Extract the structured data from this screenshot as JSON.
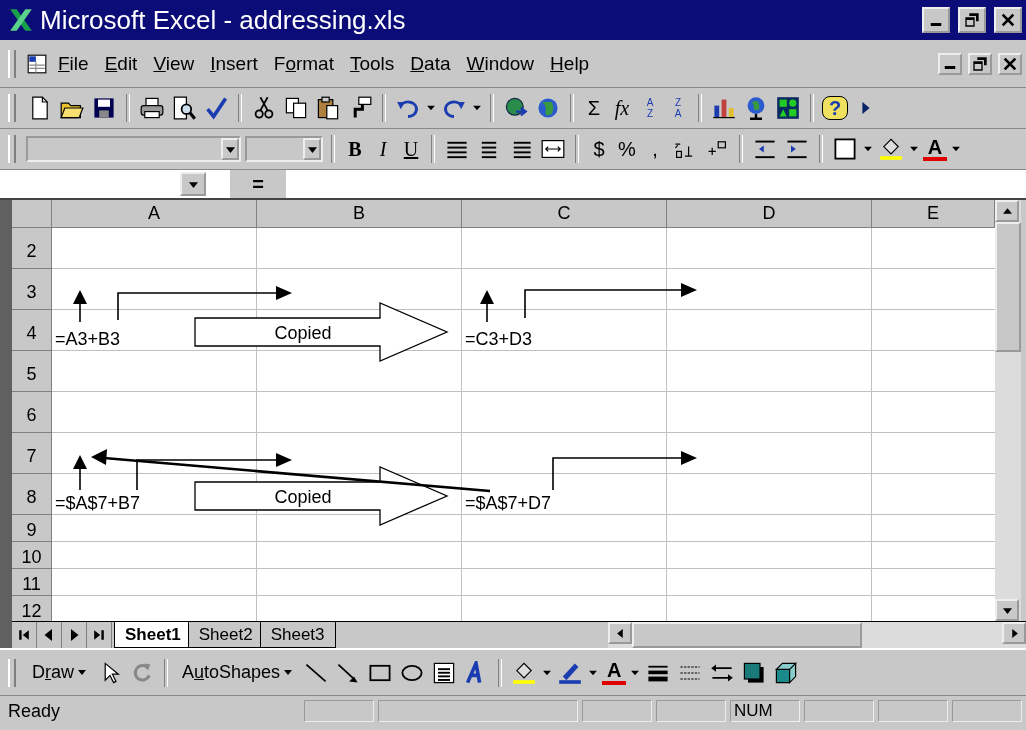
{
  "window": {
    "title": "Microsoft Excel - addressing.xls"
  },
  "menu": [
    {
      "key": "F",
      "rest": "ile"
    },
    {
      "key": "E",
      "rest": "dit"
    },
    {
      "key": "V",
      "rest": "iew"
    },
    {
      "key": "I",
      "rest": "nsert"
    },
    {
      "lead": "F",
      "key": "o",
      "rest": "rmat"
    },
    {
      "key": "T",
      "rest": "ools"
    },
    {
      "key": "D",
      "rest": "ata"
    },
    {
      "key": "W",
      "rest": "indow"
    },
    {
      "key": "H",
      "rest": "elp"
    }
  ],
  "standard_toolbar": [
    {
      "kind": "new"
    },
    {
      "kind": "open"
    },
    {
      "kind": "save"
    },
    {
      "kind": "sep"
    },
    {
      "kind": "print"
    },
    {
      "kind": "preview"
    },
    {
      "kind": "spell"
    },
    {
      "kind": "sep"
    },
    {
      "kind": "cut"
    },
    {
      "kind": "copy"
    },
    {
      "kind": "paste"
    },
    {
      "kind": "painter"
    },
    {
      "kind": "sep"
    },
    {
      "kind": "undo"
    },
    {
      "kind": "caret"
    },
    {
      "kind": "redo"
    },
    {
      "kind": "caret"
    },
    {
      "kind": "sep"
    },
    {
      "kind": "hyperlink"
    },
    {
      "kind": "web"
    },
    {
      "kind": "sep"
    },
    {
      "kind": "text",
      "label": "Σ"
    },
    {
      "kind": "italic",
      "label": "fx"
    },
    {
      "kind": "sort",
      "top": "A",
      "bottom": "Z"
    },
    {
      "kind": "sort",
      "top": "Z",
      "bottom": "A"
    },
    {
      "kind": "sep"
    },
    {
      "kind": "chart"
    },
    {
      "kind": "map"
    },
    {
      "kind": "drawing"
    },
    {
      "kind": "sep"
    },
    {
      "kind": "help",
      "label": "?"
    },
    {
      "kind": "more"
    }
  ],
  "formatting_toolbar": [
    {
      "kind": "fontbox"
    },
    {
      "kind": "sizebox"
    },
    {
      "kind": "sep"
    },
    {
      "kind": "bold",
      "label": "B"
    },
    {
      "kind": "italic",
      "label": "I"
    },
    {
      "kind": "underline",
      "label": "U"
    },
    {
      "kind": "sep"
    },
    {
      "kind": "alignleft"
    },
    {
      "kind": "center"
    },
    {
      "kind": "alignright"
    },
    {
      "kind": "merge"
    },
    {
      "kind": "sep"
    },
    {
      "kind": "text",
      "label": "$"
    },
    {
      "kind": "text",
      "label": "%"
    },
    {
      "kind": "text",
      "label": ","
    },
    {
      "kind": "incdec"
    },
    {
      "kind": "decdec"
    },
    {
      "kind": "sep"
    },
    {
      "kind": "outdent"
    },
    {
      "kind": "indent"
    },
    {
      "kind": "sep"
    },
    {
      "kind": "borders"
    },
    {
      "kind": "caret"
    },
    {
      "kind": "fill"
    },
    {
      "kind": "caret"
    },
    {
      "kind": "fontcolor",
      "label": "A"
    },
    {
      "kind": "caret"
    }
  ],
  "formula_bar": {
    "equals": "="
  },
  "columns": [
    {
      "label": "A"
    },
    {
      "label": "B"
    },
    {
      "label": "C"
    },
    {
      "label": "D"
    },
    {
      "label": "E"
    }
  ],
  "rows": [
    {
      "header": "2",
      "cells": [
        null,
        null,
        null,
        null,
        null
      ]
    },
    {
      "header": "3",
      "cells": [
        null,
        null,
        null,
        null,
        null
      ]
    },
    {
      "header": "4",
      "cells": [
        "=A3+B3",
        null,
        "=C3+D3",
        null,
        null
      ]
    },
    {
      "header": "5",
      "cells": [
        null,
        null,
        null,
        null,
        null
      ]
    },
    {
      "header": "6",
      "cells": [
        null,
        null,
        null,
        null,
        null
      ]
    },
    {
      "header": "7",
      "cells": [
        null,
        null,
        null,
        null,
        null
      ]
    },
    {
      "header": "8",
      "cells": [
        "=$A$7+B7",
        null,
        "=$A$7+D7",
        null,
        null
      ]
    },
    {
      "header": "9",
      "cells": [
        null,
        null,
        null,
        null,
        null
      ]
    },
    {
      "header": "10",
      "cells": [
        null,
        null,
        null,
        null,
        null
      ]
    },
    {
      "header": "11",
      "cells": [
        null,
        null,
        null,
        null,
        null
      ]
    },
    {
      "header": "12",
      "cells": [
        null,
        null,
        null,
        null,
        null
      ]
    }
  ],
  "block_arrows": [
    {
      "label": "Copied"
    },
    {
      "label": "Copied"
    }
  ],
  "sheet_tabs": [
    {
      "label": "Sheet1",
      "selected": true
    },
    {
      "label": "Sheet2",
      "selected": false
    },
    {
      "label": "Sheet3",
      "selected": false
    }
  ],
  "drawing_toolbar": [
    {
      "kind": "menu",
      "lead": "D",
      "key": "r",
      "rest": "aw"
    },
    {
      "kind": "pointer"
    },
    {
      "kind": "rotate"
    },
    {
      "kind": "sep"
    },
    {
      "kind": "menu",
      "lead": "A",
      "key": "u",
      "rest": "toShapes"
    },
    {
      "kind": "line"
    },
    {
      "kind": "arrow"
    },
    {
      "kind": "rect"
    },
    {
      "kind": "oval"
    },
    {
      "kind": "textbox"
    },
    {
      "kind": "wordart"
    },
    {
      "kind": "sep"
    },
    {
      "kind": "fill"
    },
    {
      "kind": "caret"
    },
    {
      "kind": "pen"
    },
    {
      "kind": "caret"
    },
    {
      "kind": "fontcolor",
      "label": "A"
    },
    {
      "kind": "caret"
    },
    {
      "kind": "lineweight"
    },
    {
      "kind": "dash"
    },
    {
      "kind": "arrowstyle"
    },
    {
      "kind": "shadow"
    },
    {
      "kind": "cube"
    }
  ],
  "status_bar": {
    "text": "Ready",
    "panels": [
      {
        "kind": "empty"
      },
      {
        "kind": "empty"
      },
      {
        "kind": "empty"
      },
      {
        "kind": "empty"
      },
      {
        "kind": "indicator",
        "text": "NUM"
      },
      {
        "kind": "empty"
      },
      {
        "kind": "empty"
      },
      {
        "kind": "empty"
      }
    ]
  }
}
